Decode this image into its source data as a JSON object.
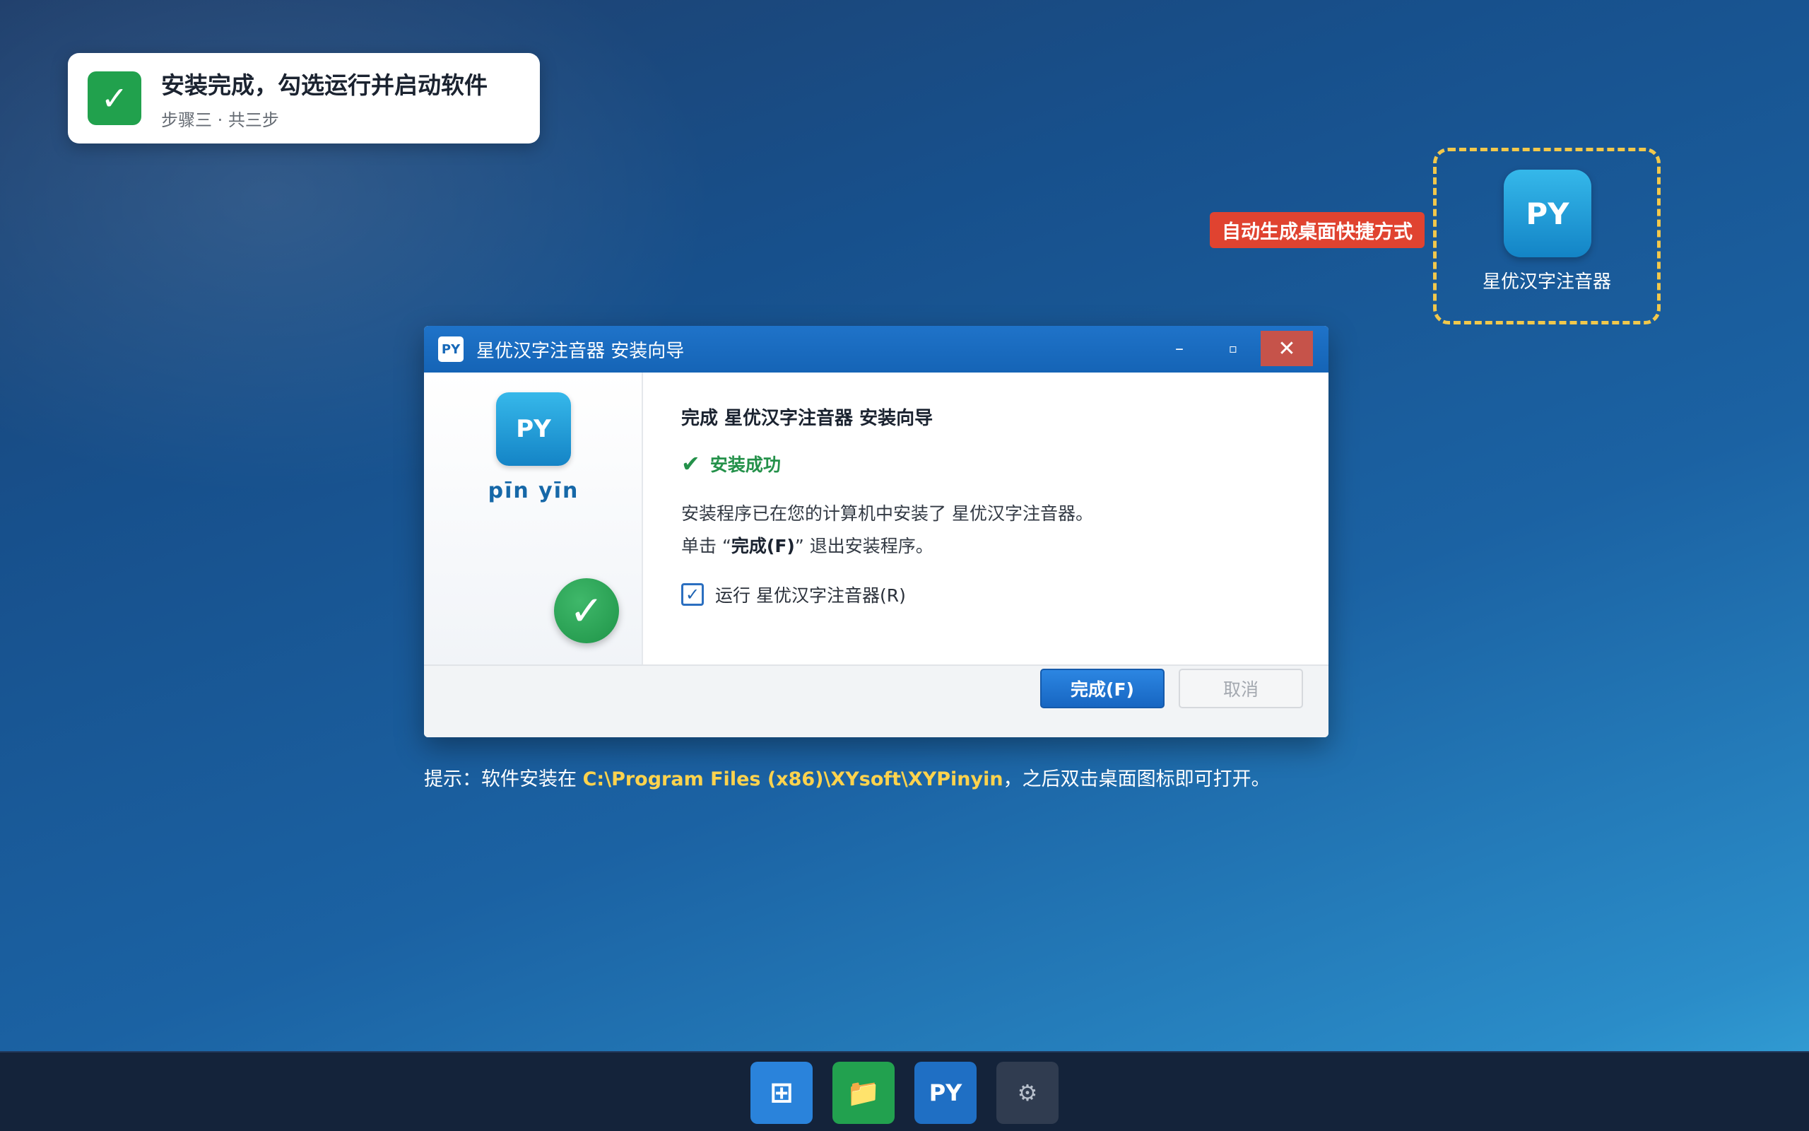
{
  "toast": {
    "title": "安装完成，勾选运行并启动软件",
    "subtitle": "步骤三 · 共三步",
    "icon": "check-icon"
  },
  "desktop_shortcut": {
    "tag": "自动生成桌面快捷方式",
    "icon_text": "PY",
    "label": "星优汉字注音器"
  },
  "dialog": {
    "title": "星优汉字注音器 安装向导",
    "title_icon_text": "PY",
    "window_controls": {
      "minimize": "–",
      "maximize": "▫",
      "close": "✕"
    },
    "sidebar": {
      "logo_text": "PY",
      "pinyin": "pīn yīn"
    },
    "heading": "完成 星优汉字注音器 安装向导",
    "success_text": "安装成功",
    "line1": "安装程序已在您的计算机中安装了 星优汉字注音器。",
    "line2_prefix": "单击 “",
    "line2_bold": "完成(F)",
    "line2_suffix": "” 退出安装程序。",
    "run_checkbox": {
      "label": "运行 星优汉字注音器(R)",
      "checked": true
    },
    "finish_button": "完成(F)",
    "cancel_button": "取消"
  },
  "hint": {
    "prefix": "提示：软件安装在 ",
    "path": "C:\\Program Files (x86)\\XYsoft\\XYPinyin",
    "suffix": "，之后双击桌面图标即可打开。"
  },
  "taskbar": {
    "items": [
      {
        "name": "start-icon",
        "glyph": "⊞"
      },
      {
        "name": "folder-icon",
        "glyph": "📁"
      },
      {
        "name": "pinyin-app-icon",
        "glyph": "PY"
      },
      {
        "name": "gear-icon",
        "glyph": "⚙"
      }
    ]
  },
  "colors": {
    "accent": "#1766c2",
    "success": "#21a14d",
    "tag": "#e04330",
    "highlight": "#ffd34d"
  }
}
